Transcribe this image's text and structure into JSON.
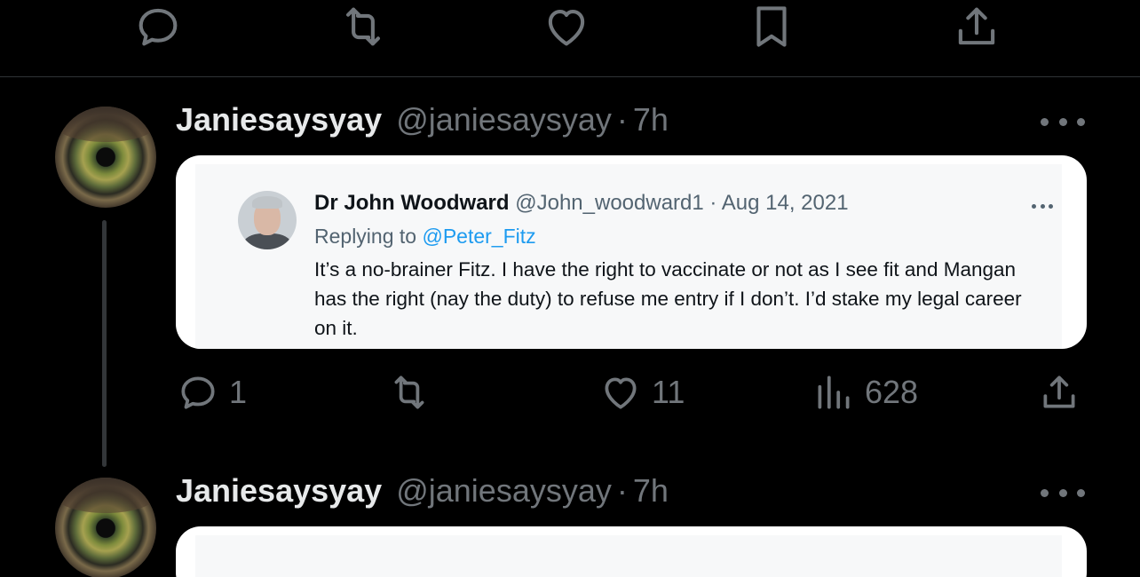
{
  "top_actions": {
    "reply_icon": "reply-bubble-icon",
    "retweet_icon": "retweet-icon",
    "like_icon": "heart-icon",
    "bookmark_icon": "bookmark-icon",
    "share_icon": "share-icon"
  },
  "tweets": [
    {
      "display_name": "Janiesaysyay",
      "handle": "@janiesaysyay",
      "separator": "·",
      "time": "7h",
      "quoted_screenshot": {
        "display_name": "Dr John Woodward",
        "handle": "@John_woodward1",
        "separator": "·",
        "date": "Aug 14, 2021",
        "replying_prefix": "Replying to",
        "replying_to": "@Peter_Fitz",
        "body": "It’s a no-brainer Fitz. I have the right to vaccinate or not as I see fit and Mangan has the right (nay the duty) to refuse me entry if I don’t.  I’d stake my legal career on it."
      },
      "engagement": {
        "replies": "1",
        "retweets": "",
        "likes": "11",
        "views": "628"
      }
    },
    {
      "display_name": "Janiesaysyay",
      "handle": "@janiesaysyay",
      "separator": "·",
      "time": "7h"
    }
  ],
  "colors": {
    "background": "#000000",
    "primary_text": "#e7e9ea",
    "secondary_text": "#71767b",
    "divider": "#2f3336",
    "link": "#1d9bf0"
  }
}
